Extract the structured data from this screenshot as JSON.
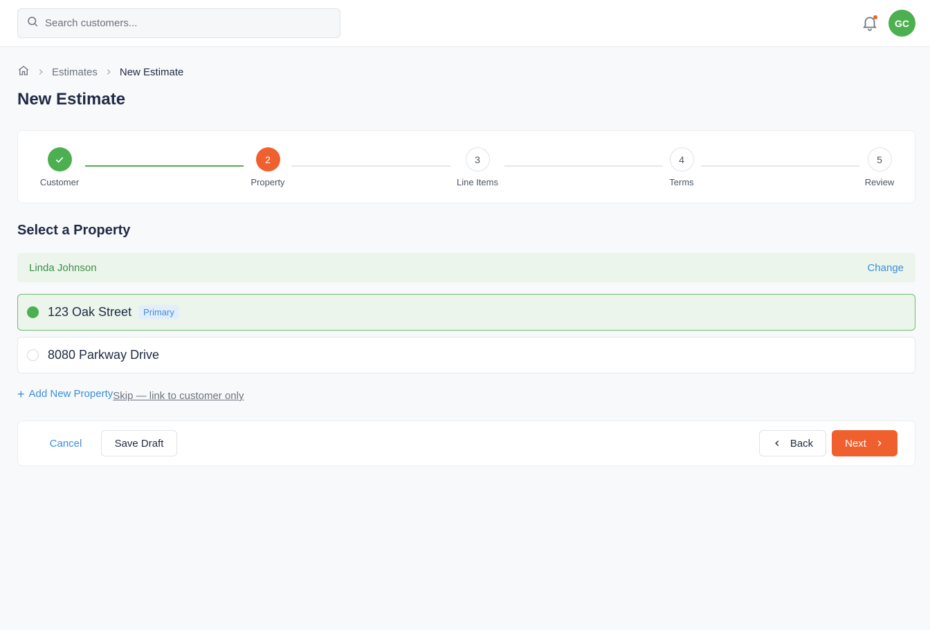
{
  "search": {
    "placeholder": "Search customers..."
  },
  "user": {
    "initials": "GC"
  },
  "breadcrumb": {
    "items": [
      "Estimates",
      "New Estimate"
    ]
  },
  "page": {
    "title": "New Estimate"
  },
  "steps": [
    {
      "number": "1",
      "label": "Customer",
      "state": "done"
    },
    {
      "number": "2",
      "label": "Property",
      "state": "active"
    },
    {
      "number": "3",
      "label": "Line Items",
      "state": "todo"
    },
    {
      "number": "4",
      "label": "Terms",
      "state": "todo"
    },
    {
      "number": "5",
      "label": "Review",
      "state": "todo"
    }
  ],
  "section": {
    "title": "Select a Property"
  },
  "customer": {
    "name": "Linda Johnson",
    "change_label": "Change"
  },
  "properties": [
    {
      "address": "123 Oak Street",
      "badge": "Primary",
      "selected": true
    },
    {
      "address": "8080 Parkway Drive",
      "badge": "",
      "selected": false
    }
  ],
  "links": {
    "add_property": "Add New Property",
    "skip": "Skip — link to customer only"
  },
  "footer": {
    "cancel": "Cancel",
    "save_draft": "Save Draft",
    "back": "Back",
    "next": "Next"
  },
  "colors": {
    "accent": "#f0602f",
    "success": "#4caf50",
    "link": "#3b8ede"
  }
}
